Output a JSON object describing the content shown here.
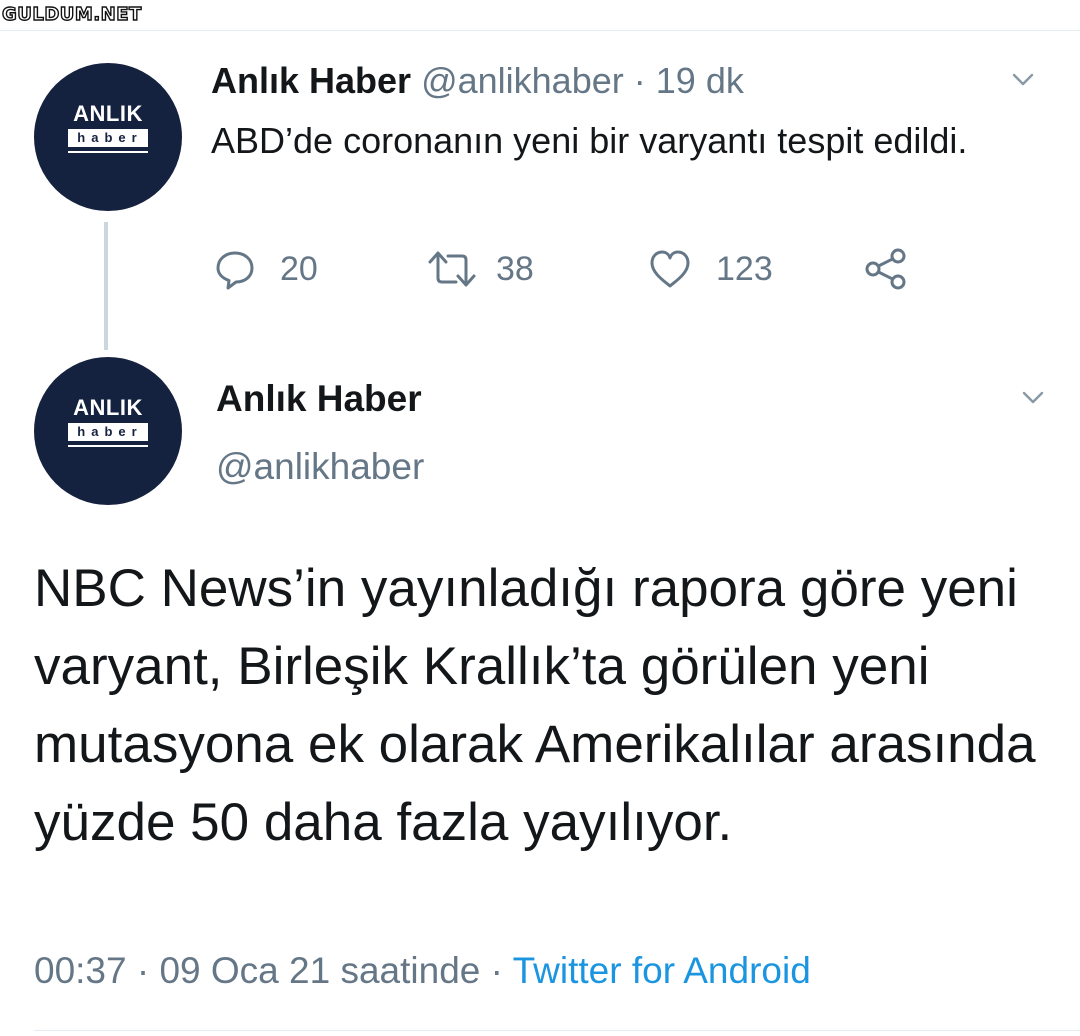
{
  "watermark": "GULDUM.NET",
  "avatar": {
    "top_text": "ANLIK",
    "box_text": "haber"
  },
  "tweet1": {
    "display_name": "Anlık Haber",
    "handle": "@anlikhaber",
    "separator": "·",
    "time": "19 dk",
    "text": "ABD’de coronanın yeni bir varyantı tespit edildi.",
    "replies": "20",
    "retweets": "38",
    "likes": "123"
  },
  "tweet2": {
    "display_name": "Anlık Haber",
    "handle": "@anlikhaber",
    "text": "NBC News’in yayınladığı rapora göre yeni varyant, Birleşik Krallık’ta görülen yeni mutasyona ek olarak Amerikalılar arasında yüzde 50 daha fazla yayılıyor.",
    "timestamp": "00:37 · 09 Oca 21 saatinde",
    "meta_separator": " · ",
    "source": "Twitter for Android"
  },
  "colors": {
    "muted": "#657786",
    "link": "#1b95e0",
    "avatar_bg": "#15223f"
  },
  "icons": [
    "reply-icon",
    "retweet-icon",
    "like-icon",
    "share-icon",
    "chevron-down-icon"
  ]
}
